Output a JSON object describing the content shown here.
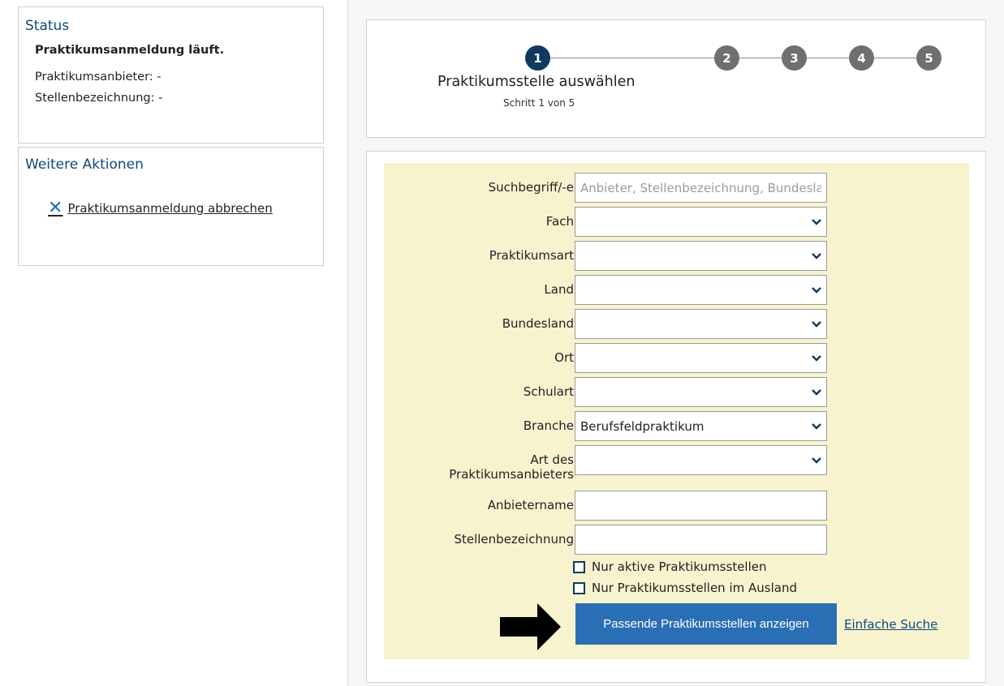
{
  "status": {
    "title": "Status",
    "state": "Praktikumsanmeldung läuft.",
    "provider": "Praktikumsanbieter: -",
    "position": "Stellenbezeichnung: -"
  },
  "actions": {
    "title": "Weitere Aktionen",
    "cancel_label": "Praktikumsanmeldung abbrechen",
    "cancel_icon_color": "#1f6fb8"
  },
  "stepper": {
    "steps": [
      "1",
      "2",
      "3",
      "4",
      "5"
    ],
    "active_step": 1,
    "title": "Praktikumsstelle auswählen",
    "subtitle": "Schritt 1 von 5",
    "active_color": "#0e3a60",
    "inactive_color": "#6f6f6f"
  },
  "form": {
    "background": "#f8f3cf",
    "search_terms": {
      "label": "Suchbegriff/-e",
      "placeholder": "Anbieter, Stellenbezeichnung, Bundesland, Ort",
      "value": ""
    },
    "fach": {
      "label": "Fach",
      "value": ""
    },
    "praktikumsart": {
      "label": "Praktikumsart",
      "value": ""
    },
    "land": {
      "label": "Land",
      "value": ""
    },
    "bundesland": {
      "label": "Bundesland",
      "value": ""
    },
    "ort": {
      "label": "Ort",
      "value": ""
    },
    "schulart": {
      "label": "Schulart",
      "value": ""
    },
    "branche": {
      "label": "Branche",
      "value": "Berufsfeldpraktikum"
    },
    "anbieterart": {
      "label_line1": "Art des",
      "label_line2": "Praktikumsanbieters",
      "value": ""
    },
    "anbietername": {
      "label": "Anbietername",
      "value": ""
    },
    "stellenbezeichnung": {
      "label": "Stellenbezeichnung",
      "value": ""
    },
    "only_active": {
      "label": "Nur aktive Praktikumsstellen",
      "checked": false
    },
    "only_abroad": {
      "label": "Nur Praktikumsstellen im Ausland",
      "checked": false
    },
    "submit_label": "Passende Praktikumsstellen anzeigen",
    "submit_color": "#2a6fb4",
    "simple_search_label": "Einfache Suche"
  }
}
